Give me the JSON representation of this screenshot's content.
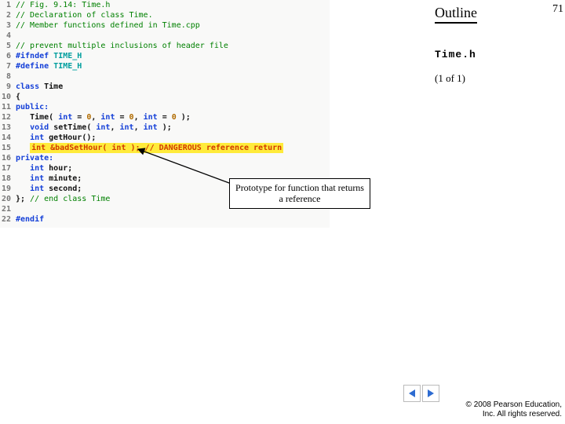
{
  "slide": {
    "page_number": "71",
    "outline_title": "Outline",
    "file_name": "Time.h",
    "page_of": "(1 of 1)",
    "callout_text": "Prototype for function that returns a reference",
    "copyright_line1": "© 2008 Pearson Education,",
    "copyright_line2": "Inc. All rights reserved."
  },
  "code": {
    "lines": [
      {
        "n": "1",
        "kind": "comment",
        "text": "// Fig. 9.14: Time.h"
      },
      {
        "n": "2",
        "kind": "comment",
        "text": "// Declaration of class Time."
      },
      {
        "n": "3",
        "kind": "comment",
        "text": "// Member functions defined in Time.cpp"
      },
      {
        "n": "4",
        "kind": "blank",
        "text": ""
      },
      {
        "n": "5",
        "kind": "comment",
        "text": "// prevent multiple inclusions of header file"
      },
      {
        "n": "6",
        "kind": "pp",
        "pp": "#ifndef",
        "id": "TIME_H"
      },
      {
        "n": "7",
        "kind": "pp",
        "pp": "#define",
        "id": "TIME_H"
      },
      {
        "n": "8",
        "kind": "blank",
        "text": ""
      },
      {
        "n": "9",
        "kind": "class",
        "kw": "class",
        "name": "Time"
      },
      {
        "n": "10",
        "kind": "plain",
        "text": "{"
      },
      {
        "n": "11",
        "kind": "access",
        "kw": "public:"
      },
      {
        "n": "12",
        "kind": "ctor",
        "indent": "   ",
        "name": "Time",
        "kw1": "int",
        "eq1": "=",
        "v1": "0",
        "c1": ",",
        "kw2": "int",
        "eq2": "=",
        "v2": "0",
        "c2": ",",
        "kw3": "int",
        "eq3": "=",
        "v3": "0",
        "close": " );"
      },
      {
        "n": "13",
        "kind": "settime",
        "indent": "   ",
        "ret": "void",
        "name": "setTime",
        "kw1": "int",
        "c1": ",",
        "kw2": "int",
        "c2": ",",
        "kw3": "int",
        "close": " );"
      },
      {
        "n": "14",
        "kind": "gethour",
        "indent": "   ",
        "ret": "int",
        "name": "getHour",
        "close": "();"
      },
      {
        "n": "15",
        "kind": "hl",
        "indent": "   ",
        "text": "int &badSetHour( int ); // DANGEROUS reference return"
      },
      {
        "n": "16",
        "kind": "access",
        "kw": "private:"
      },
      {
        "n": "17",
        "kind": "member",
        "indent": "   ",
        "type": "int",
        "name": "hour",
        "semi": ";"
      },
      {
        "n": "18",
        "kind": "member",
        "indent": "   ",
        "type": "int",
        "name": "minute",
        "semi": ";"
      },
      {
        "n": "19",
        "kind": "member",
        "indent": "   ",
        "type": "int",
        "name": "second",
        "semi": ";"
      },
      {
        "n": "20",
        "kind": "endclass",
        "text_dark": "}; ",
        "comment": "// end class Time"
      },
      {
        "n": "21",
        "kind": "blank",
        "text": ""
      },
      {
        "n": "22",
        "kind": "endif",
        "pp": "#endif"
      }
    ]
  }
}
